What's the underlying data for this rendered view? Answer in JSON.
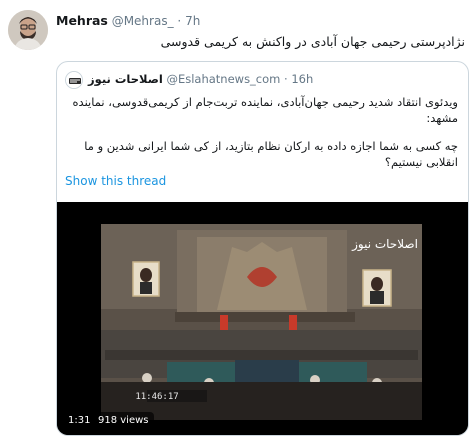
{
  "tweet": {
    "display_name": "Mehras",
    "handle": "@Mehras_",
    "separator": "·",
    "time": "7h",
    "text": "نژادپرستی رحیمی جهان آبادی در واکنش به کریمی قدوسی"
  },
  "quoted_tweet": {
    "display_name": "اصلاحات نیوز",
    "handle": "@Eslahatnews_com",
    "separator": "·",
    "time": "16h",
    "paragraph_1": "ویدئوی انتقاد شدید رحیمی جهان‌آبادی، نماینده تربت‌جام از کریمی‌قدوسی، نماینده مشهد:",
    "paragraph_2": "چه کسی به شما اجازه داده به ارکان نظام بتازید، از کی شما ایرانی شدین و ما انقلابی نیستیم؟",
    "show_thread_label": "Show this thread"
  },
  "video": {
    "duration": "1:31",
    "views": "918 views",
    "overlay_caption": "اصلاحات نیوز",
    "timestamp": "11:46:17"
  },
  "colors": {
    "link": "#1b95e0",
    "muted": "#657786",
    "border": "#ccd6dd"
  }
}
